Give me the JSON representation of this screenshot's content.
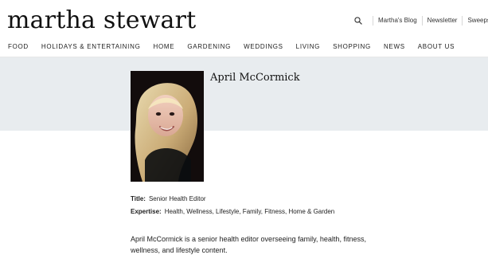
{
  "site": {
    "logo_text": "martha stewart"
  },
  "header": {
    "utility_links": [
      {
        "label": "Martha's Blog"
      },
      {
        "label": "Newsletter"
      },
      {
        "label": "Sweepstakes"
      }
    ],
    "icons": {
      "search": "search-icon"
    }
  },
  "nav": {
    "items": [
      {
        "label": "FOOD"
      },
      {
        "label": "HOLIDAYS & ENTERTAINING"
      },
      {
        "label": "HOME"
      },
      {
        "label": "GARDENING"
      },
      {
        "label": "WEDDINGS"
      },
      {
        "label": "LIVING"
      },
      {
        "label": "SHOPPING"
      },
      {
        "label": "NEWS"
      },
      {
        "label": "ABOUT US"
      }
    ]
  },
  "author": {
    "name": "April McCormick",
    "title_label": "Title:",
    "title_value": "Senior Health Editor",
    "expertise_label": "Expertise:",
    "expertise_value": "Health, Wellness, Lifestyle, Family, Fitness, Home & Garden",
    "bio": "April McCormick is a senior health editor overseeing family, health, fitness, wellness, and lifestyle content."
  },
  "colors": {
    "hero_bg": "#e8ecef",
    "photo_bg": "#120c0c"
  }
}
